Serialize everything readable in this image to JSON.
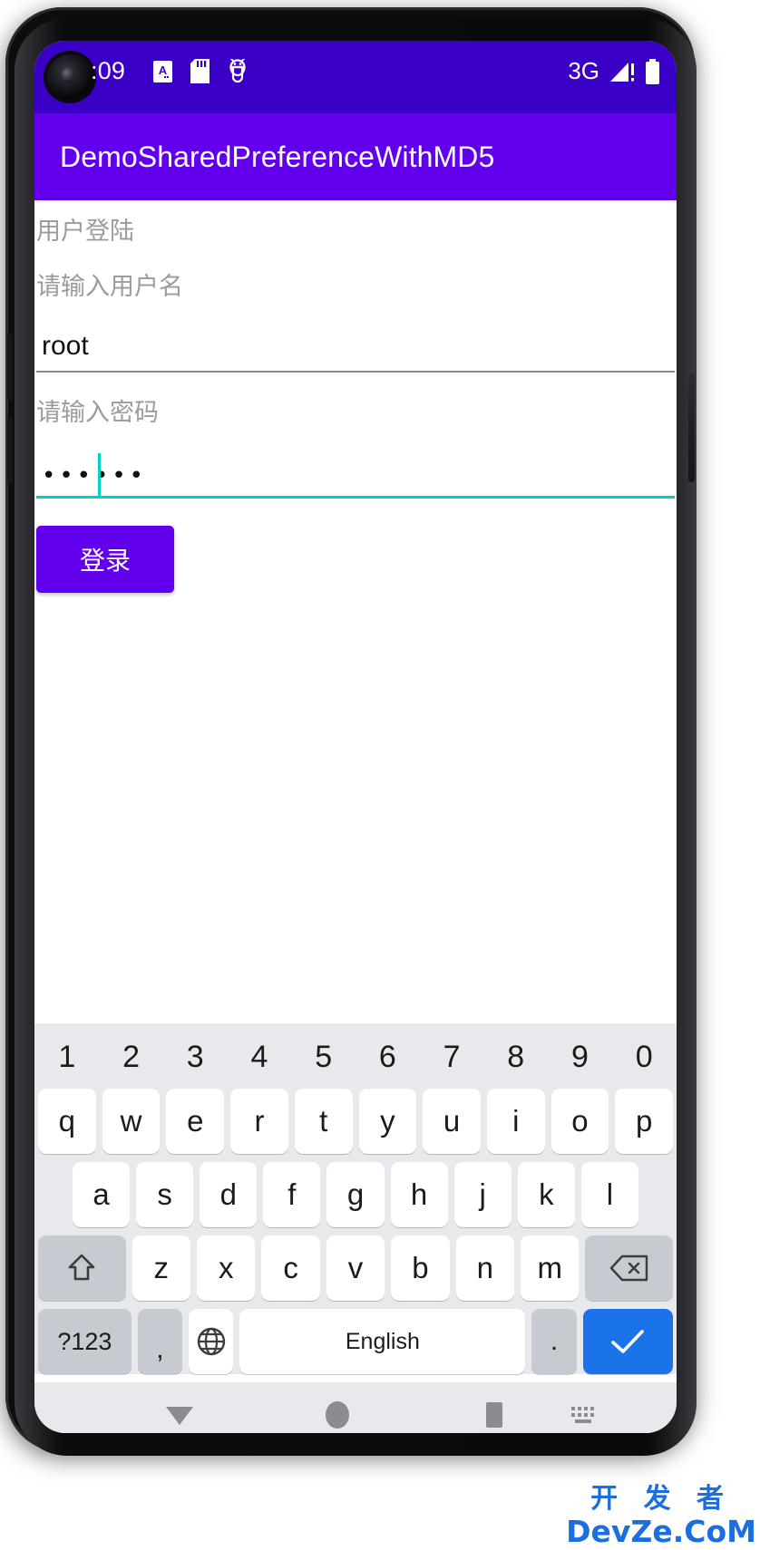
{
  "status_bar": {
    "clock": ":09",
    "network": "3G",
    "icons": [
      "alarm-a-icon",
      "sd-card-icon",
      "adb-icon",
      "signal-icon",
      "battery-icon"
    ],
    "background": "#3a00c8"
  },
  "app_bar": {
    "title": "DemoSharedPreferenceWithMD5",
    "background": "#6200ee"
  },
  "form": {
    "section_label": "用户登陆",
    "username": {
      "hint": "请输入用户名",
      "value": "root",
      "placeholder": "请输入用户名"
    },
    "password": {
      "hint": "请输入密码",
      "value": "••••••",
      "placeholder": "请输入密码",
      "masked_length": 6,
      "focused": true,
      "accent": "#00d4c0"
    },
    "login_button": "登录"
  },
  "keyboard": {
    "language": "English",
    "rows": {
      "numbers": [
        "1",
        "2",
        "3",
        "4",
        "5",
        "6",
        "7",
        "8",
        "9",
        "0"
      ],
      "top": [
        "q",
        "w",
        "e",
        "r",
        "t",
        "y",
        "u",
        "i",
        "o",
        "p"
      ],
      "home": [
        "a",
        "s",
        "d",
        "f",
        "g",
        "h",
        "j",
        "k",
        "l"
      ],
      "bottom": [
        "z",
        "x",
        "c",
        "v",
        "b",
        "n",
        "m"
      ]
    },
    "shift_label": "shift-icon",
    "backspace_label": "backspace-icon",
    "symbols_key": "?123",
    "comma_key": ",",
    "period_key": ".",
    "globe_key": "globe-icon",
    "enter_key": "checkmark-icon",
    "enter_color": "#1a73e8"
  },
  "nav_bar": {
    "back": "back-triangle-icon",
    "home": "home-circle-icon",
    "recents": "recents-square-icon",
    "keyboard_switch": "keyboard-switch-icon"
  },
  "watermark": {
    "cn": "开 发 者",
    "en": "DevZe.CoM",
    "color": "#1a6fe0"
  }
}
